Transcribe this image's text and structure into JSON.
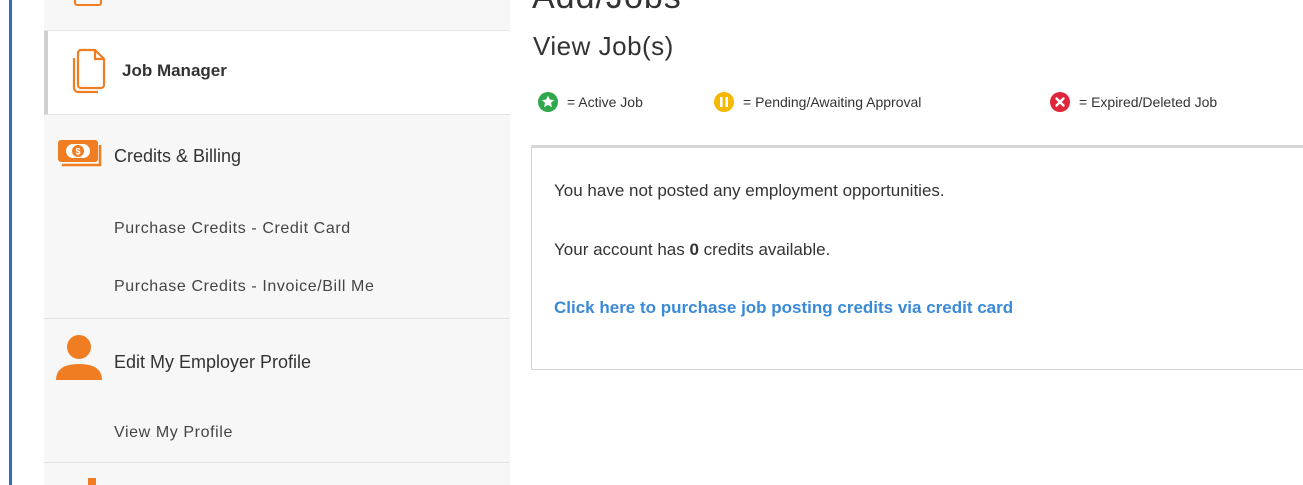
{
  "sidebar": {
    "job_manager_label": "Job Manager",
    "credits_billing_label": "Credits & Billing",
    "purchase_credit_card_label": "Purchase Credits - Credit Card",
    "purchase_invoice_label": "Purchase Credits - Invoice/Bill Me",
    "edit_profile_label": "Edit My Employer Profile",
    "view_profile_label": "View My Profile"
  },
  "main": {
    "partial_title": "Add/Jobs",
    "page_title": "View Job(s)",
    "legend": [
      {
        "icon": "active-star-icon",
        "color": "#2ea84a",
        "text": "= Active Job"
      },
      {
        "icon": "pending-pause-icon",
        "color": "#f5b800",
        "text": "= Pending/Awaiting Approval"
      },
      {
        "icon": "expired-x-icon",
        "color": "#e0263a",
        "text": "= Expired/Deleted Job"
      }
    ],
    "panel": {
      "message": "You have not posted any employment opportunities.",
      "credits_prefix": "Your account has ",
      "credits_count": "0",
      "credits_suffix": " credits available.",
      "purchase_link": "Click here to purchase job posting credits via credit card"
    }
  },
  "colors": {
    "accent_orange": "#f07d22",
    "link_blue": "#3b8ad8",
    "left_rule_blue": "#2f6fb8"
  }
}
